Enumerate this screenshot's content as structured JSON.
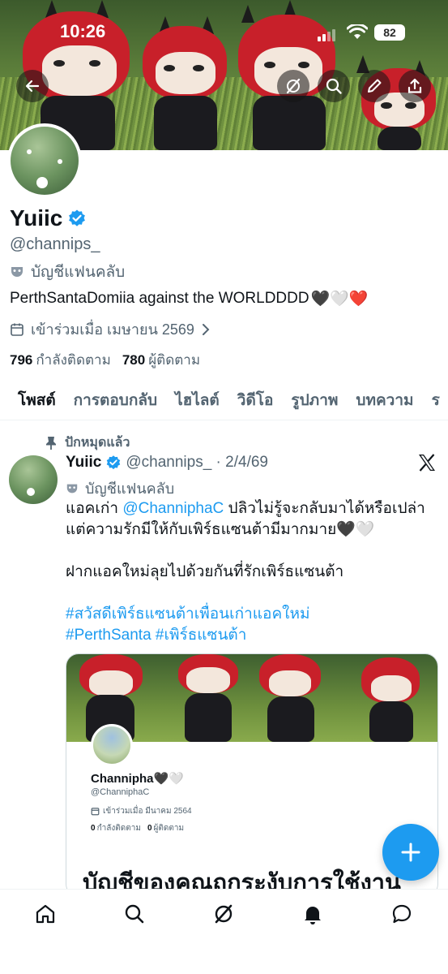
{
  "status_bar": {
    "time": "10:26",
    "battery": "82"
  },
  "banner": {
    "back_icon": "arrow-left-icon",
    "grok_icon": "grok-icon",
    "search_icon": "search-icon",
    "edit_icon": "pencil-icon",
    "share_icon": "share-icon"
  },
  "profile": {
    "name": "Yuiic",
    "handle": "@channips_",
    "account_label": "บัญชีแฟนคลับ",
    "bio": "PerthSantaDomiia against the WORLDDDD",
    "bio_emoji": "🖤🤍❤️",
    "joined": "เข้าร่วมเมื่อ เมษายน 2569",
    "following_count": "796",
    "following_label": "กำลังติดตาม",
    "followers_count": "780",
    "followers_label": "ผู้ติดตาม"
  },
  "tabs": [
    "โพสต์",
    "การตอบกลับ",
    "ไฮไลต์",
    "วิดีโอ",
    "รูปภาพ",
    "บทความ",
    "ร"
  ],
  "post": {
    "pinned_label": "ปักหมุดแล้ว",
    "name": "Yuiic",
    "handle_date": "@channips_ · 2/4/69",
    "account_label": "บัญชีแฟนคลับ",
    "line1_prefix": "แอคเก่า ",
    "line1_mention": "@ChanniphaC",
    "line1_suffix": " ปลิวไม่รู้จะกลับมาได้หรือเปล่า",
    "line2": "แต่ความรักมีให้กับเพิร์ธแซนต้ามีมากมาย🖤🤍",
    "line3": "ฝากแอคใหม่ลุยไปด้วยกันที่รักเพิร์ธแซนต้า",
    "hashtags1": "#สวัสดีเพิร์ธแซนต้าเพื่อนเก่าแอคใหม่",
    "hashtags2": "#PerthSanta #เพิร์ธแซนต้า"
  },
  "media_card": {
    "name": "Channipha🖤🤍",
    "handle": "@ChanniphaC",
    "joined": "เข้าร่วมเมื่อ มีนาคม 2564",
    "following_count": "0",
    "following_label": "กำลังติดตาม",
    "followers_count": "0",
    "followers_label": "ผู้ติดตาม",
    "suspended_text": "บัญชีของคุณถูกระงับการใช้งาน"
  },
  "bottom_nav": [
    "home-icon",
    "search-icon",
    "grok-icon",
    "notifications-icon",
    "messages-icon"
  ],
  "colors": {
    "accent": "#1d9bf0",
    "text": "#0f1419",
    "secondary": "#536471"
  }
}
